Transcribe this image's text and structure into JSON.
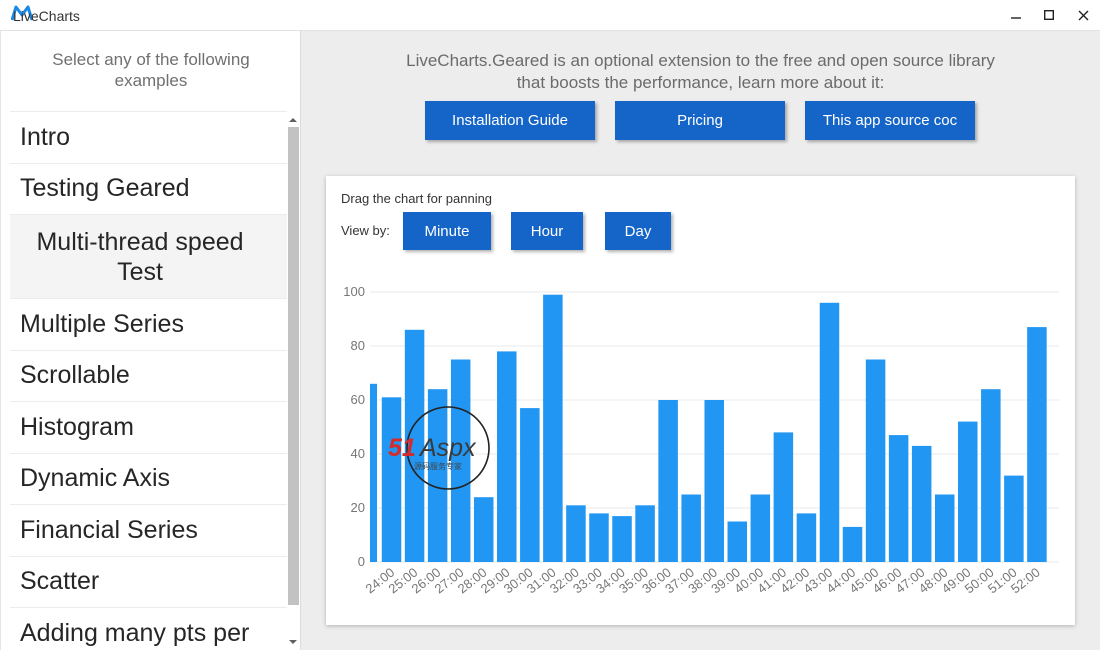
{
  "window": {
    "title": "LiveCharts"
  },
  "sidebar": {
    "header": [
      "Select any of the following",
      "examples"
    ],
    "items": [
      {
        "label": "Intro"
      },
      {
        "label": "Testing Geared"
      },
      {
        "label": "Multi-thread speed Test"
      },
      {
        "label": "Multiple Series"
      },
      {
        "label": "Scrollable"
      },
      {
        "label": "Histogram"
      },
      {
        "label": "Dynamic Axis"
      },
      {
        "label": "Financial Series"
      },
      {
        "label": "Scatter"
      },
      {
        "label": "Adding many pts per"
      }
    ],
    "selected_index": 2
  },
  "main": {
    "intro": [
      "LiveCharts.Geared is an optional extension to the free and open source library",
      "that boosts the performance, learn more about it:"
    ],
    "buttons": [
      {
        "label": "Installation Guide"
      },
      {
        "label": "Pricing"
      },
      {
        "label": "This app source coc"
      }
    ],
    "card": {
      "title": "Drag the chart for panning",
      "view_by_label": "View by:",
      "view_buttons": [
        {
          "label": "Minute"
        },
        {
          "label": "Hour"
        },
        {
          "label": "Day"
        }
      ]
    }
  },
  "watermark": {
    "brand": "51Aspx",
    "subtitle": "源码服务专家"
  },
  "colors": {
    "accent": "#1565c8",
    "bar": "#2196f3",
    "main_bg": "#ededed"
  },
  "chart_data": {
    "type": "bar",
    "title": "",
    "xlabel": "",
    "ylabel": "",
    "ylim": [
      0,
      100
    ],
    "yticks": [
      0,
      20,
      40,
      60,
      80,
      100
    ],
    "grid": true,
    "categories": [
      "24:00",
      "25:00",
      "26:00",
      "27:00",
      "28:00",
      "29:00",
      "30:00",
      "31:00",
      "32:00",
      "33:00",
      "34:00",
      "35:00",
      "36:00",
      "37:00",
      "38:00",
      "39:00",
      "40:00",
      "41:00",
      "42:00",
      "43:00",
      "44:00",
      "45:00",
      "46:00",
      "47:00",
      "48:00",
      "49:00",
      "50:00",
      "51:00",
      "52:00"
    ],
    "leading_partial_value": 66,
    "values": [
      61,
      86,
      64,
      75,
      24,
      78,
      57,
      99,
      21,
      18,
      17,
      21,
      60,
      25,
      60,
      15,
      25,
      48,
      18,
      96,
      13,
      75,
      47,
      43,
      25,
      52,
      64,
      32,
      87
    ]
  }
}
